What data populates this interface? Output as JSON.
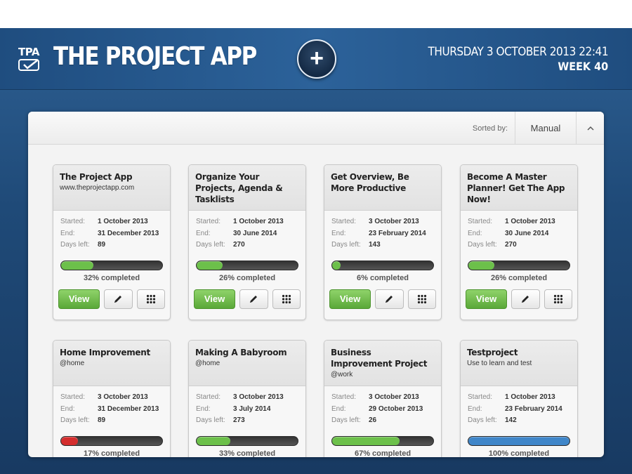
{
  "header": {
    "logo_text": "TPA",
    "title": "THE PROJECT APP",
    "add_label": "+",
    "date": "THURSDAY 3 OCTOBER 2013 22:41",
    "week": "WEEK 40"
  },
  "sort": {
    "label": "Sorted by:",
    "value": "Manual",
    "toggle_icon": "chevron-up"
  },
  "labels": {
    "started": "Started:",
    "end": "End:",
    "days_left": "Days left:",
    "view": "View"
  },
  "colors": {
    "green": "#6cc04a",
    "red": "#d42e2e",
    "blue": "#3f86c9"
  },
  "projects": [
    {
      "title": "The Project App",
      "subtitle": "www.theprojectapp.com",
      "started": "1 October 2013",
      "end": "31 December 2013",
      "days_left": "89",
      "progress": 0.32,
      "progress_text": "32% completed",
      "bar_color": "green"
    },
    {
      "title": "Organize Your Projects, Agenda & Tasklists",
      "subtitle": "",
      "started": "1 October 2013",
      "end": "30 June 2014",
      "days_left": "270",
      "progress": 0.26,
      "progress_text": "26% completed",
      "bar_color": "green"
    },
    {
      "title": "Get Overview, Be More Productive",
      "subtitle": "",
      "started": "3 October 2013",
      "end": "23 February 2014",
      "days_left": "143",
      "progress": 0.06,
      "progress_text": "6% completed",
      "bar_color": "green"
    },
    {
      "title": "Become A Master Planner! Get The App Now!",
      "subtitle": "",
      "started": "1 October 2013",
      "end": "30 June 2014",
      "days_left": "270",
      "progress": 0.26,
      "progress_text": "26% completed",
      "bar_color": "green"
    },
    {
      "title": "Home Improvement",
      "subtitle": "@home",
      "started": "3 October 2013",
      "end": "31 December 2013",
      "days_left": "89",
      "progress": 0.17,
      "progress_text": "17% completed",
      "bar_color": "red"
    },
    {
      "title": "Making A Babyroom",
      "subtitle": "@home",
      "started": "3 October 2013",
      "end": "3 July 2014",
      "days_left": "273",
      "progress": 0.33,
      "progress_text": "33% completed",
      "bar_color": "green"
    },
    {
      "title": "Business Improvement Project",
      "subtitle": "@work",
      "started": "3 October 2013",
      "end": "29 October 2013",
      "days_left": "26",
      "progress": 0.67,
      "progress_text": "67% completed",
      "bar_color": "green"
    },
    {
      "title": "Testproject",
      "subtitle": "Use to learn and test",
      "started": "1 October 2013",
      "end": "23 February 2014",
      "days_left": "142",
      "progress": 1.0,
      "progress_text": "100% completed",
      "bar_color": "blue"
    }
  ]
}
